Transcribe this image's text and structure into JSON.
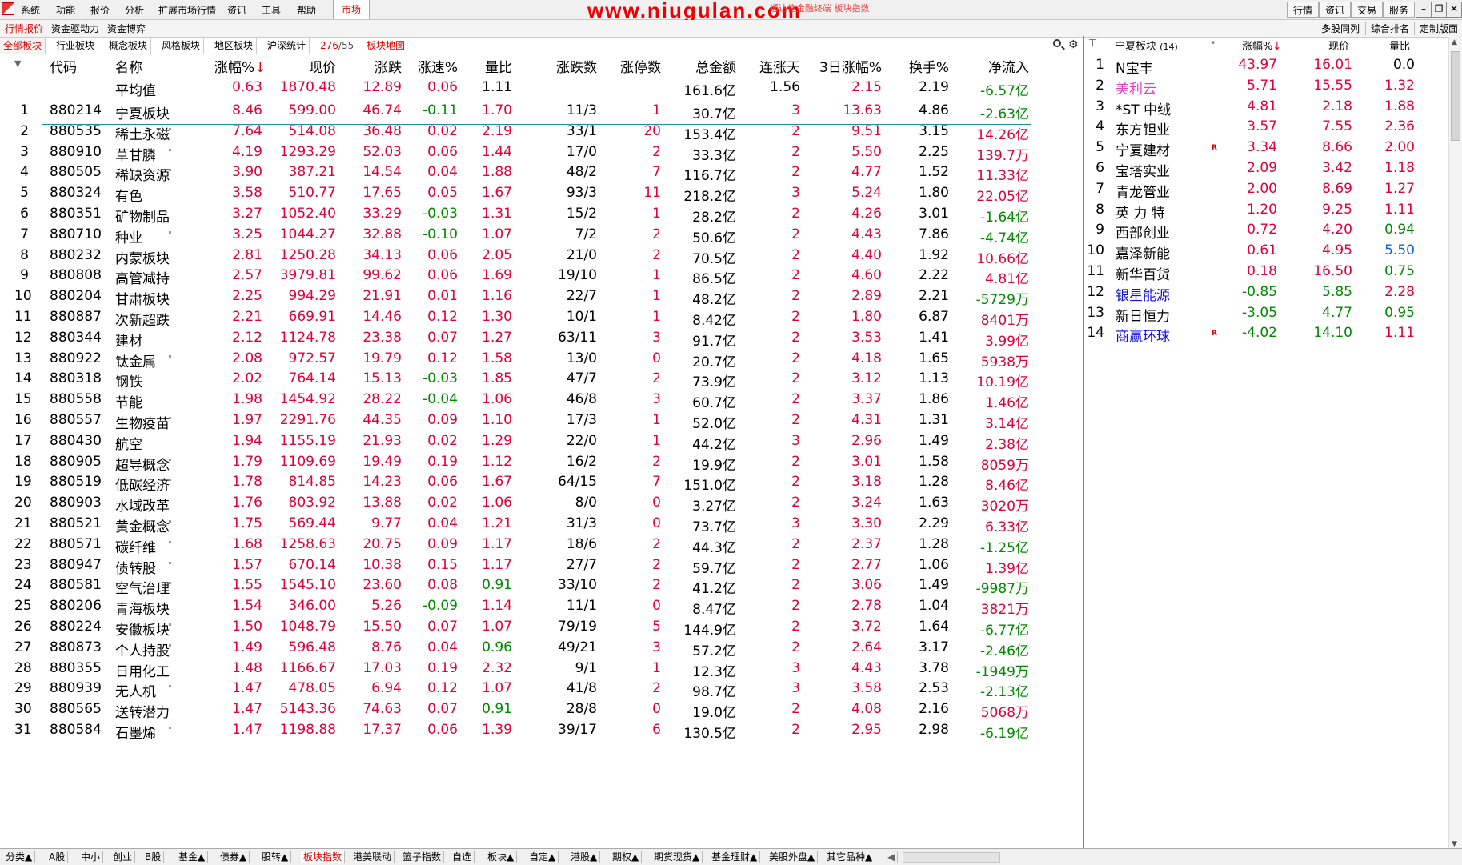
{
  "menubar": {
    "items": [
      "系统",
      "功能",
      "报价",
      "分析",
      "扩展市场行情",
      "资讯",
      "工具",
      "帮助"
    ],
    "market_tab": "市场",
    "watermark": "www.niugulan.com",
    "watermark_sub": "通达信金融终端 板块指数",
    "right_buttons": [
      "行情",
      "资讯",
      "交易",
      "服务"
    ]
  },
  "row2": {
    "tabs": [
      "行情报价",
      "资金驱动力",
      "资金博弈"
    ],
    "right": [
      "多股同列",
      "综合排名",
      "定制版面"
    ]
  },
  "row3": {
    "tabs": [
      "全部板块",
      "行业板块",
      "概念板块",
      "风格板块",
      "地区板块",
      "沪深统计"
    ],
    "count_current": "276",
    "count_total": "/55",
    "map_tab": "板块地图"
  },
  "table": {
    "headers": [
      "代码",
      "名称",
      "涨幅%",
      "现价",
      "涨跌",
      "涨速%",
      "量比",
      "涨跌数",
      "涨停数",
      "总金额",
      "连涨天",
      "3日涨幅%",
      "换手%",
      "净流入"
    ],
    "sort_arrow": "↓",
    "avg_row": {
      "label": "平均值",
      "chg": "0.63",
      "price": "1870.48",
      "diff": "12.89",
      "speed": "0.06",
      "vol_ratio": "1.11",
      "amount": "161.6亿",
      "days": "1.56",
      "chg3": "2.15",
      "turnover": "2.19",
      "net": "-6.57亿"
    },
    "rows": [
      {
        "n": "1",
        "code": "880214",
        "name": "宁夏板块",
        "chg": "8.46",
        "price": "599.00",
        "diff": "46.74",
        "speed": "-0.11",
        "vr": "1.70",
        "ud": "11/3",
        "lim": "1",
        "amt": "30.7亿",
        "days": "3",
        "c3": "13.63",
        "to": "4.86",
        "net": "-2.63亿"
      },
      {
        "n": "2",
        "code": "880535",
        "name": "稀土永磁",
        "chg": "7.64",
        "price": "514.08",
        "diff": "36.48",
        "speed": "0.02",
        "vr": "2.19",
        "ud": "33/1",
        "lim": "20",
        "amt": "153.4亿",
        "days": "2",
        "c3": "9.51",
        "to": "3.15",
        "net": "14.26亿"
      },
      {
        "n": "3",
        "code": "880910",
        "name": "草甘膦",
        "chg": "4.19",
        "price": "1293.29",
        "diff": "52.03",
        "speed": "0.06",
        "vr": "1.44",
        "ud": "17/0",
        "lim": "2",
        "amt": "33.3亿",
        "days": "2",
        "c3": "5.50",
        "to": "2.25",
        "net": "139.7万"
      },
      {
        "n": "4",
        "code": "880505",
        "name": "稀缺资源",
        "chg": "3.90",
        "price": "387.21",
        "diff": "14.54",
        "speed": "0.04",
        "vr": "1.88",
        "ud": "48/2",
        "lim": "7",
        "amt": "116.7亿",
        "days": "2",
        "c3": "4.77",
        "to": "1.52",
        "net": "11.33亿"
      },
      {
        "n": "5",
        "code": "880324",
        "name": "有色",
        "chg": "3.58",
        "price": "510.77",
        "diff": "17.65",
        "speed": "0.05",
        "vr": "1.67",
        "ud": "93/3",
        "lim": "11",
        "amt": "218.2亿",
        "days": "3",
        "c3": "5.24",
        "to": "1.80",
        "net": "22.05亿"
      },
      {
        "n": "6",
        "code": "880351",
        "name": "矿物制品",
        "chg": "3.27",
        "price": "1052.40",
        "diff": "33.29",
        "speed": "-0.03",
        "vr": "1.31",
        "ud": "15/2",
        "lim": "1",
        "amt": "28.2亿",
        "days": "2",
        "c3": "4.26",
        "to": "3.01",
        "net": "-1.64亿"
      },
      {
        "n": "7",
        "code": "880710",
        "name": "种业",
        "chg": "3.25",
        "price": "1044.27",
        "diff": "32.88",
        "speed": "-0.10",
        "vr": "1.07",
        "ud": "7/2",
        "lim": "2",
        "amt": "50.6亿",
        "days": "2",
        "c3": "4.43",
        "to": "7.86",
        "net": "-4.74亿"
      },
      {
        "n": "8",
        "code": "880232",
        "name": "内蒙板块",
        "chg": "2.81",
        "price": "1250.28",
        "diff": "34.13",
        "speed": "0.06",
        "vr": "2.05",
        "ud": "21/0",
        "lim": "2",
        "amt": "70.5亿",
        "days": "2",
        "c3": "4.40",
        "to": "1.92",
        "net": "10.66亿"
      },
      {
        "n": "9",
        "code": "880808",
        "name": "高管减持",
        "chg": "2.57",
        "price": "3979.81",
        "diff": "99.62",
        "speed": "0.06",
        "vr": "1.69",
        "ud": "19/10",
        "lim": "1",
        "amt": "86.5亿",
        "days": "2",
        "c3": "4.60",
        "to": "2.22",
        "net": "4.81亿"
      },
      {
        "n": "10",
        "code": "880204",
        "name": "甘肃板块",
        "chg": "2.25",
        "price": "994.29",
        "diff": "21.91",
        "speed": "0.01",
        "vr": "1.16",
        "ud": "22/7",
        "lim": "1",
        "amt": "48.2亿",
        "days": "2",
        "c3": "2.89",
        "to": "2.21",
        "net": "-5729万"
      },
      {
        "n": "11",
        "code": "880887",
        "name": "次新超跌",
        "chg": "2.21",
        "price": "669.91",
        "diff": "14.46",
        "speed": "0.12",
        "vr": "1.30",
        "ud": "10/1",
        "lim": "1",
        "amt": "8.42亿",
        "days": "2",
        "c3": "1.80",
        "to": "6.87",
        "net": "8401万"
      },
      {
        "n": "12",
        "code": "880344",
        "name": "建材",
        "chg": "2.12",
        "price": "1124.78",
        "diff": "23.38",
        "speed": "0.07",
        "vr": "1.27",
        "ud": "63/11",
        "lim": "3",
        "amt": "91.7亿",
        "days": "2",
        "c3": "3.53",
        "to": "1.41",
        "net": "3.99亿"
      },
      {
        "n": "13",
        "code": "880922",
        "name": "钛金属",
        "chg": "2.08",
        "price": "972.57",
        "diff": "19.79",
        "speed": "0.12",
        "vr": "1.58",
        "ud": "13/0",
        "lim": "0",
        "amt": "20.7亿",
        "days": "2",
        "c3": "4.18",
        "to": "1.65",
        "net": "5938万"
      },
      {
        "n": "14",
        "code": "880318",
        "name": "钢铁",
        "chg": "2.02",
        "price": "764.14",
        "diff": "15.13",
        "speed": "-0.03",
        "vr": "1.85",
        "ud": "47/7",
        "lim": "2",
        "amt": "73.9亿",
        "days": "2",
        "c3": "3.12",
        "to": "1.13",
        "net": "10.19亿"
      },
      {
        "n": "15",
        "code": "880558",
        "name": "节能",
        "chg": "1.98",
        "price": "1454.92",
        "diff": "28.22",
        "speed": "-0.04",
        "vr": "1.06",
        "ud": "46/8",
        "lim": "3",
        "amt": "60.7亿",
        "days": "2",
        "c3": "3.37",
        "to": "1.86",
        "net": "1.46亿"
      },
      {
        "n": "16",
        "code": "880557",
        "name": "生物疫苗",
        "chg": "1.97",
        "price": "2291.76",
        "diff": "44.35",
        "speed": "0.09",
        "vr": "1.10",
        "ud": "17/3",
        "lim": "1",
        "amt": "52.0亿",
        "days": "2",
        "c3": "4.31",
        "to": "1.31",
        "net": "3.14亿"
      },
      {
        "n": "17",
        "code": "880430",
        "name": "航空",
        "chg": "1.94",
        "price": "1155.19",
        "diff": "21.93",
        "speed": "0.02",
        "vr": "1.29",
        "ud": "22/0",
        "lim": "1",
        "amt": "44.2亿",
        "days": "3",
        "c3": "2.96",
        "to": "1.49",
        "net": "2.38亿"
      },
      {
        "n": "18",
        "code": "880905",
        "name": "超导概念",
        "chg": "1.79",
        "price": "1109.69",
        "diff": "19.49",
        "speed": "0.19",
        "vr": "1.12",
        "ud": "16/2",
        "lim": "2",
        "amt": "19.9亿",
        "days": "2",
        "c3": "3.01",
        "to": "1.58",
        "net": "8059万"
      },
      {
        "n": "19",
        "code": "880519",
        "name": "低碳经济",
        "chg": "1.78",
        "price": "814.85",
        "diff": "14.23",
        "speed": "0.06",
        "vr": "1.67",
        "ud": "64/15",
        "lim": "7",
        "amt": "151.0亿",
        "days": "2",
        "c3": "3.18",
        "to": "1.28",
        "net": "8.46亿"
      },
      {
        "n": "20",
        "code": "880903",
        "name": "水域改革",
        "chg": "1.76",
        "price": "803.92",
        "diff": "13.88",
        "speed": "0.02",
        "vr": "1.06",
        "ud": "8/0",
        "lim": "0",
        "amt": "3.27亿",
        "days": "2",
        "c3": "3.24",
        "to": "1.63",
        "net": "3020万"
      },
      {
        "n": "21",
        "code": "880521",
        "name": "黄金概念",
        "chg": "1.75",
        "price": "569.44",
        "diff": "9.77",
        "speed": "0.04",
        "vr": "1.21",
        "ud": "31/3",
        "lim": "0",
        "amt": "73.7亿",
        "days": "3",
        "c3": "3.30",
        "to": "2.29",
        "net": "6.33亿"
      },
      {
        "n": "22",
        "code": "880571",
        "name": "碳纤维",
        "chg": "1.68",
        "price": "1258.63",
        "diff": "20.75",
        "speed": "0.09",
        "vr": "1.17",
        "ud": "18/6",
        "lim": "2",
        "amt": "44.3亿",
        "days": "2",
        "c3": "2.37",
        "to": "1.28",
        "net": "-1.25亿"
      },
      {
        "n": "23",
        "code": "880947",
        "name": "债转股",
        "chg": "1.57",
        "price": "670.14",
        "diff": "10.38",
        "speed": "0.15",
        "vr": "1.17",
        "ud": "27/7",
        "lim": "2",
        "amt": "59.7亿",
        "days": "2",
        "c3": "2.77",
        "to": "1.06",
        "net": "1.39亿"
      },
      {
        "n": "24",
        "code": "880581",
        "name": "空气治理",
        "chg": "1.55",
        "price": "1545.10",
        "diff": "23.60",
        "speed": "0.08",
        "vr": "0.91",
        "ud": "33/10",
        "lim": "2",
        "amt": "41.2亿",
        "days": "2",
        "c3": "3.06",
        "to": "1.49",
        "net": "-9987万"
      },
      {
        "n": "25",
        "code": "880206",
        "name": "青海板块",
        "chg": "1.54",
        "price": "346.00",
        "diff": "5.26",
        "speed": "-0.09",
        "vr": "1.14",
        "ud": "11/1",
        "lim": "0",
        "amt": "8.47亿",
        "days": "2",
        "c3": "2.78",
        "to": "1.04",
        "net": "3821万"
      },
      {
        "n": "26",
        "code": "880224",
        "name": "安徽板块",
        "chg": "1.50",
        "price": "1048.79",
        "diff": "15.50",
        "speed": "0.07",
        "vr": "1.07",
        "ud": "79/19",
        "lim": "5",
        "amt": "144.9亿",
        "days": "2",
        "c3": "3.72",
        "to": "1.64",
        "net": "-6.77亿"
      },
      {
        "n": "27",
        "code": "880873",
        "name": "个人持股",
        "chg": "1.49",
        "price": "596.48",
        "diff": "8.76",
        "speed": "0.04",
        "vr": "0.96",
        "ud": "49/21",
        "lim": "3",
        "amt": "57.2亿",
        "days": "2",
        "c3": "2.64",
        "to": "3.17",
        "net": "-2.46亿"
      },
      {
        "n": "28",
        "code": "880355",
        "name": "日用化工",
        "chg": "1.48",
        "price": "1166.67",
        "diff": "17.03",
        "speed": "0.19",
        "vr": "2.32",
        "ud": "9/1",
        "lim": "1",
        "amt": "12.3亿",
        "days": "3",
        "c3": "4.43",
        "to": "3.78",
        "net": "-1949万"
      },
      {
        "n": "29",
        "code": "880939",
        "name": "无人机",
        "chg": "1.47",
        "price": "478.05",
        "diff": "6.94",
        "speed": "0.12",
        "vr": "1.07",
        "ud": "41/8",
        "lim": "2",
        "amt": "98.7亿",
        "days": "3",
        "c3": "3.58",
        "to": "2.53",
        "net": "-2.13亿"
      },
      {
        "n": "30",
        "code": "880565",
        "name": "送转潜力",
        "chg": "1.47",
        "price": "5143.36",
        "diff": "74.63",
        "speed": "0.07",
        "vr": "0.91",
        "ud": "28/8",
        "lim": "0",
        "amt": "19.0亿",
        "days": "2",
        "c3": "4.08",
        "to": "2.16",
        "net": "5068万"
      },
      {
        "n": "31",
        "code": "880584",
        "name": "石墨烯",
        "chg": "1.47",
        "price": "1198.88",
        "diff": "17.37",
        "speed": "0.06",
        "vr": "1.39",
        "ud": "39/17",
        "lim": "6",
        "amt": "130.5亿",
        "days": "2",
        "c3": "2.95",
        "to": "2.98",
        "net": "-6.19亿"
      }
    ]
  },
  "right_panel": {
    "title": "宁夏板块",
    "count": "(14)",
    "headers": [
      "涨幅%",
      "现价",
      "量比"
    ],
    "sort_arrow": "↓",
    "rows": [
      {
        "n": "1",
        "name": "N宝丰",
        "chg": "43.97",
        "price": "16.01",
        "vr": "0.0",
        "name_color": "black",
        "badge": ""
      },
      {
        "n": "2",
        "name": "美利云",
        "chg": "5.71",
        "price": "15.55",
        "vr": "1.32",
        "name_color": "pink",
        "badge": ""
      },
      {
        "n": "3",
        "name": "*ST 中绒",
        "chg": "4.81",
        "price": "2.18",
        "vr": "1.88",
        "name_color": "black",
        "badge": ""
      },
      {
        "n": "4",
        "name": "东方钽业",
        "chg": "3.57",
        "price": "7.55",
        "vr": "2.36",
        "name_color": "black",
        "badge": ""
      },
      {
        "n": "5",
        "name": "宁夏建材",
        "chg": "3.34",
        "price": "8.66",
        "vr": "2.00",
        "name_color": "black",
        "badge": "R"
      },
      {
        "n": "6",
        "name": "宝塔实业",
        "chg": "2.09",
        "price": "3.42",
        "vr": "1.18",
        "name_color": "black",
        "badge": ""
      },
      {
        "n": "7",
        "name": "青龙管业",
        "chg": "2.00",
        "price": "8.69",
        "vr": "1.27",
        "name_color": "black",
        "badge": ""
      },
      {
        "n": "8",
        "name": "英 力 特",
        "chg": "1.20",
        "price": "9.25",
        "vr": "1.11",
        "name_color": "black",
        "badge": ""
      },
      {
        "n": "9",
        "name": "西部创业",
        "chg": "0.72",
        "price": "4.20",
        "vr": "0.94",
        "name_color": "black",
        "badge": ""
      },
      {
        "n": "10",
        "name": "嘉泽新能",
        "chg": "0.61",
        "price": "4.95",
        "vr": "5.50",
        "name_color": "black",
        "badge": ""
      },
      {
        "n": "11",
        "name": "新华百货",
        "chg": "0.18",
        "price": "16.50",
        "vr": "0.75",
        "name_color": "black",
        "badge": ""
      },
      {
        "n": "12",
        "name": "银星能源",
        "chg": "-0.85",
        "price": "5.85",
        "vr": "2.28",
        "name_color": "blue",
        "badge": ""
      },
      {
        "n": "13",
        "name": "新日恒力",
        "chg": "-3.05",
        "price": "4.77",
        "vr": "0.95",
        "name_color": "black",
        "badge": ""
      },
      {
        "n": "14",
        "name": "商赢环球",
        "chg": "-4.02",
        "price": "14.10",
        "vr": "1.11",
        "name_color": "blue",
        "badge": "R"
      }
    ]
  },
  "bottom_tabs": [
    "分类▲",
    "A股",
    "中小",
    "创业",
    "B股",
    "基金▲",
    "债券▲",
    "股转▲",
    "板块指数",
    "港美联动",
    "篮子指数",
    "自选",
    "板块▲",
    "自定▲",
    "港股▲",
    "期权▲",
    "期货现货▲",
    "基金理财▲",
    "美股外盘▲",
    "其它品种▲"
  ],
  "bottom_active": "板块指数",
  "colors": {
    "up": "#e0003a",
    "down": "#008a00",
    "accent": "#d00000",
    "selected_line": "#1a8fa0"
  }
}
